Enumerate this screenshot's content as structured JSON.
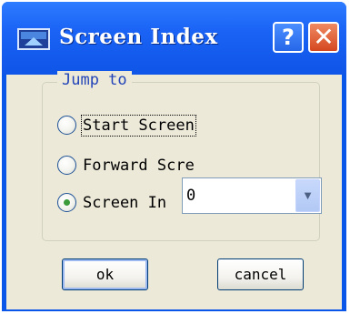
{
  "window": {
    "title": "Screen Index",
    "help_label": "?",
    "close_label": "✕"
  },
  "group": {
    "label": "Jump to",
    "options": [
      {
        "label": "Start Screen",
        "selected": false,
        "focused": true
      },
      {
        "label": "Forward Scre",
        "selected": false,
        "focused": false
      },
      {
        "label": "Screen In",
        "selected": true,
        "focused": false
      }
    ]
  },
  "screen_index_combo": {
    "value": "0",
    "arrow": "▼"
  },
  "buttons": {
    "ok_label": "ok",
    "cancel_label": "cancel"
  },
  "colors": {
    "titlebar": "#0a56e8",
    "client_bg": "#ece9d8",
    "group_label": "#2244b8",
    "close_button": "#d4471f"
  }
}
